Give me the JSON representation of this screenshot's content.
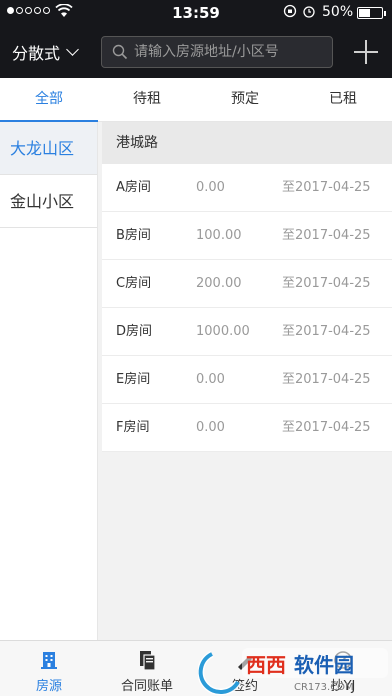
{
  "status_bar": {
    "time": "13:59",
    "battery": "50%",
    "battery_level": 0.5,
    "signal_dots_filled": 1,
    "signal_dots_total": 5
  },
  "nav": {
    "mode_label": "分散式",
    "search_placeholder": "请输入房源地址/小区号"
  },
  "tabs": [
    {
      "label": "全部",
      "active": true
    },
    {
      "label": "待租",
      "active": false
    },
    {
      "label": "预定",
      "active": false
    },
    {
      "label": "已租",
      "active": false
    }
  ],
  "sidebar": {
    "items": [
      {
        "label": "大龙山区",
        "active": true
      },
      {
        "label": "金山小区",
        "active": false
      }
    ]
  },
  "content": {
    "section_title": "港城路",
    "rows": [
      {
        "room": "A房间",
        "amount": "0.00",
        "date": "至2017-04-25"
      },
      {
        "room": "B房间",
        "amount": "100.00",
        "date": "至2017-04-25"
      },
      {
        "room": "C房间",
        "amount": "200.00",
        "date": "至2017-04-25"
      },
      {
        "room": "D房间",
        "amount": "1000.00",
        "date": "至2017-04-25"
      },
      {
        "room": "E房间",
        "amount": "0.00",
        "date": "至2017-04-25"
      },
      {
        "room": "F房间",
        "amount": "0.00",
        "date": "至2017-04-25"
      }
    ]
  },
  "tabbar": {
    "items": [
      {
        "label": "房源",
        "icon": "building-icon",
        "active": true
      },
      {
        "label": "合同账单",
        "icon": "document-icon",
        "active": false
      },
      {
        "label": "签约",
        "icon": "sign-icon",
        "active": false
      },
      {
        "label": "抄YJ",
        "icon": "meter-icon",
        "active": false
      }
    ]
  },
  "watermark": {
    "text": "西西软件园",
    "subtext": "CR173.COM"
  },
  "colors": {
    "accent": "#2b80e0",
    "header_bg": "#16171b"
  }
}
